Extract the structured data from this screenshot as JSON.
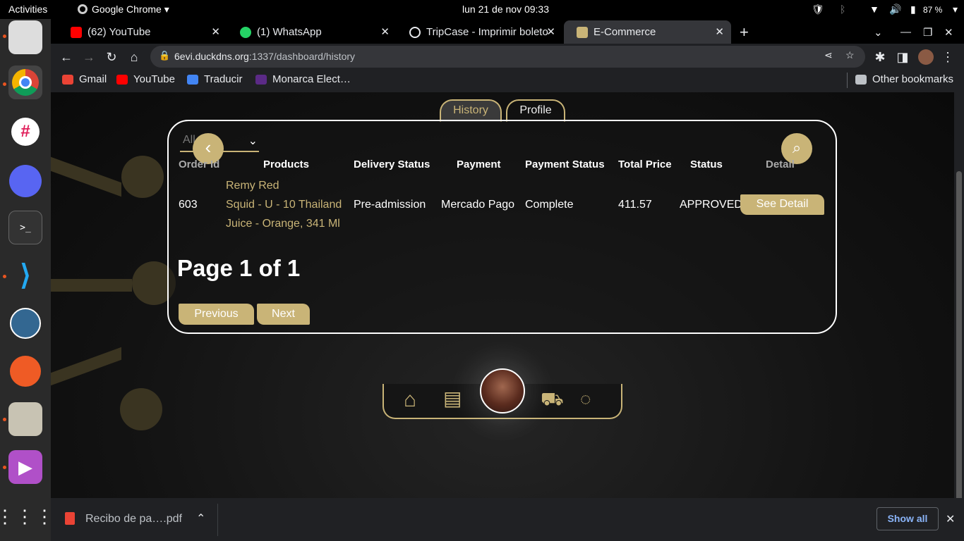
{
  "topbar": {
    "activities": "Activities",
    "app": "Google Chrome",
    "clock": "lun 21 de nov  09:33",
    "battery": "87 %"
  },
  "tabs": [
    {
      "title": "(62) YouTube",
      "color": "#ff0000"
    },
    {
      "title": "(1) WhatsApp",
      "color": "#25d366"
    },
    {
      "title": "TripCase - Imprimir boleto",
      "color": "#e8eaed"
    },
    {
      "title": "E-Commerce",
      "color": "#c9b477"
    }
  ],
  "address": {
    "host": "6evi.duckdns.org",
    "path": ":1337/dashboard/history"
  },
  "bookmarks": [
    {
      "label": "Gmail",
      "color": "#ea4335"
    },
    {
      "label": "YouTube",
      "color": "#ff0000"
    },
    {
      "label": "Traducir",
      "color": "#4285f4"
    },
    {
      "label": "Monarca Elect…",
      "color": "#5b2a86"
    }
  ],
  "other_bookmarks": "Other bookmarks",
  "page_tabs": {
    "history": "History",
    "profile": "Profile"
  },
  "filter": {
    "value": "All"
  },
  "table": {
    "headers": [
      "Order Id",
      "Products",
      "Delivery Status",
      "Payment",
      "Payment Status",
      "Total Price",
      "Status",
      "Detail"
    ],
    "rows": [
      {
        "order_id": "603",
        "products": [
          "Remy Red",
          "Squid - U - 10 Thailand",
          "Juice - Orange, 341 Ml"
        ],
        "delivery": "Pre-admission",
        "payment": "Mercado Pago",
        "payment_status": "Complete",
        "total": "411.57",
        "status": "APPROVED",
        "detail_label": "See Detail"
      }
    ]
  },
  "pagination": {
    "text": "Page 1 of 1",
    "prev": "Previous",
    "next": "Next"
  },
  "download": {
    "file": "Recibo de pa….pdf",
    "show_all": "Show all"
  },
  "colors": {
    "accent": "#c9b477"
  }
}
